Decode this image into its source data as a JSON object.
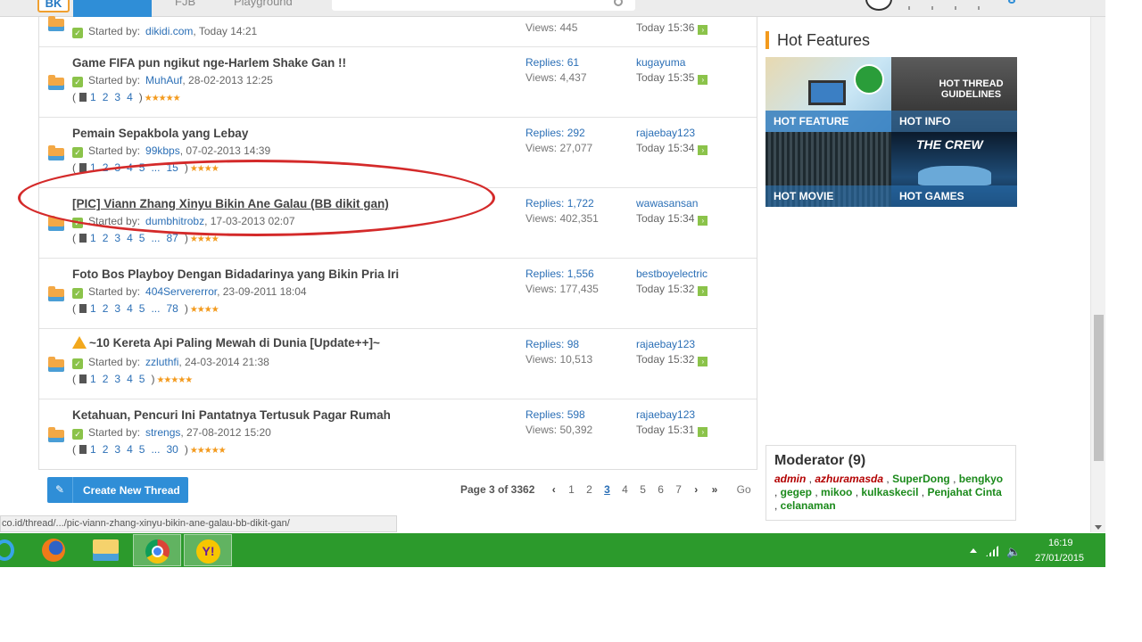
{
  "nav": {
    "logo_text": "BK",
    "fjb_label": "FJB",
    "playground_label": "Playground"
  },
  "threads": [
    {
      "title": "",
      "started_label": "Started by:",
      "author": "dikidi.com",
      "date": ", Today 14:21",
      "pages": [],
      "rating": "",
      "replies": "",
      "views": "Views: 445",
      "last_user": "",
      "last_time": "Today 15:36"
    },
    {
      "title": "Game FIFA pun ngikut nge-Harlem Shake Gan !!",
      "started_label": "Started by:",
      "author": "MuhAuf",
      "date": ", 28-02-2013 12:25",
      "pages": [
        "1",
        "2",
        "3",
        "4"
      ],
      "rating": "★★★★★",
      "replies": "Replies: 61",
      "views": "Views: 4,437",
      "last_user": "kugayuma",
      "last_time": "Today 15:35"
    },
    {
      "title": "Pemain Sepakbola yang Lebay",
      "started_label": "Started by:",
      "author": "99kbps",
      "date": ", 07-02-2013 14:39",
      "pages": [
        "1",
        "2",
        "3",
        "4",
        "5",
        "...",
        "15"
      ],
      "rating": "★★★★",
      "replies": "Replies: 292",
      "views": "Views: 27,077",
      "last_user": "rajaebay123",
      "last_time": "Today 15:34"
    },
    {
      "title": "[PIC] Viann Zhang Xinyu Bikin Ane Galau (BB dikit gan)",
      "started_label": "Started by:",
      "author": "dumbhitrobz",
      "date": ", 17-03-2013 02:07",
      "pages": [
        "1",
        "2",
        "3",
        "4",
        "5",
        "...",
        "87"
      ],
      "rating": "★★★★",
      "replies": "Replies: 1,722",
      "views": "Views: 402,351",
      "last_user": "wawasansan",
      "last_time": "Today 15:34"
    },
    {
      "title": "Foto Bos Playboy Dengan Bidadarinya yang Bikin Pria Iri",
      "started_label": "Started by:",
      "author": "404Servererror",
      "date": ", 23-09-2011 18:04",
      "pages": [
        "1",
        "2",
        "3",
        "4",
        "5",
        "...",
        "78"
      ],
      "rating": "★★★★",
      "replies": "Replies: 1,556",
      "views": "Views: 177,435",
      "last_user": "bestboyelectric",
      "last_time": "Today 15:32"
    },
    {
      "title": "~10 Kereta Api Paling Mewah di Dunia [Update++]~",
      "started_label": "Started by:",
      "author": "zzluthfi",
      "date": ", 24-03-2014 21:38",
      "pages": [
        "1",
        "2",
        "3",
        "4",
        "5"
      ],
      "rating": "★★★★★",
      "replies": "Replies: 98",
      "views": "Views: 10,513",
      "last_user": "rajaebay123",
      "last_time": "Today 15:32"
    },
    {
      "title": "Ketahuan, Pencuri Ini Pantatnya Tertusuk Pagar Rumah",
      "started_label": "Started by:",
      "author": "strengs",
      "date": ", 27-08-2012 15:20",
      "pages": [
        "1",
        "2",
        "3",
        "4",
        "5",
        "...",
        "30"
      ],
      "rating": "★★★★★",
      "replies": "Replies: 598",
      "views": "Views: 50,392",
      "last_user": "rajaebay123",
      "last_time": "Today 15:31"
    }
  ],
  "footer": {
    "create_button": "Create New Thread",
    "page_of": "Page 3 of 3362",
    "prev": "‹",
    "next": "›",
    "last": "»",
    "page_numbers": [
      "1",
      "2",
      "3",
      "4",
      "5",
      "6",
      "7"
    ],
    "current_page": "3",
    "go_label": "Go"
  },
  "sidebar": {
    "hot_features_title": "Hot Features",
    "tiles": {
      "feature": "HOT FEATURE",
      "info": "HOT INFO",
      "info_heading": "HOT THREAD GUIDELINES",
      "movie": "HOT MOVIE",
      "games": "HOT GAMES",
      "games_heading": "THE CREW"
    },
    "moderator_title": "Moderator (9)",
    "moderators_red": [
      "admin",
      "azhuramasda"
    ],
    "moderators_green": [
      "SuperDong",
      "bengkyo",
      "gegep",
      "mikoo",
      "kulkaskecil",
      "Penjahat Cinta",
      "celanaman"
    ]
  },
  "status_url": "co.id/thread/.../pic-viann-zhang-xinyu-bikin-ane-galau-bb-dikit-gan/",
  "taskbar": {
    "time": "16:19",
    "date": "27/01/2015"
  },
  "colors": {
    "accent_blue": "#2f8ed7",
    "taskbar_green": "#2c9a2c",
    "annotation_red": "#d42a2a",
    "star_orange": "#f39a1d"
  }
}
